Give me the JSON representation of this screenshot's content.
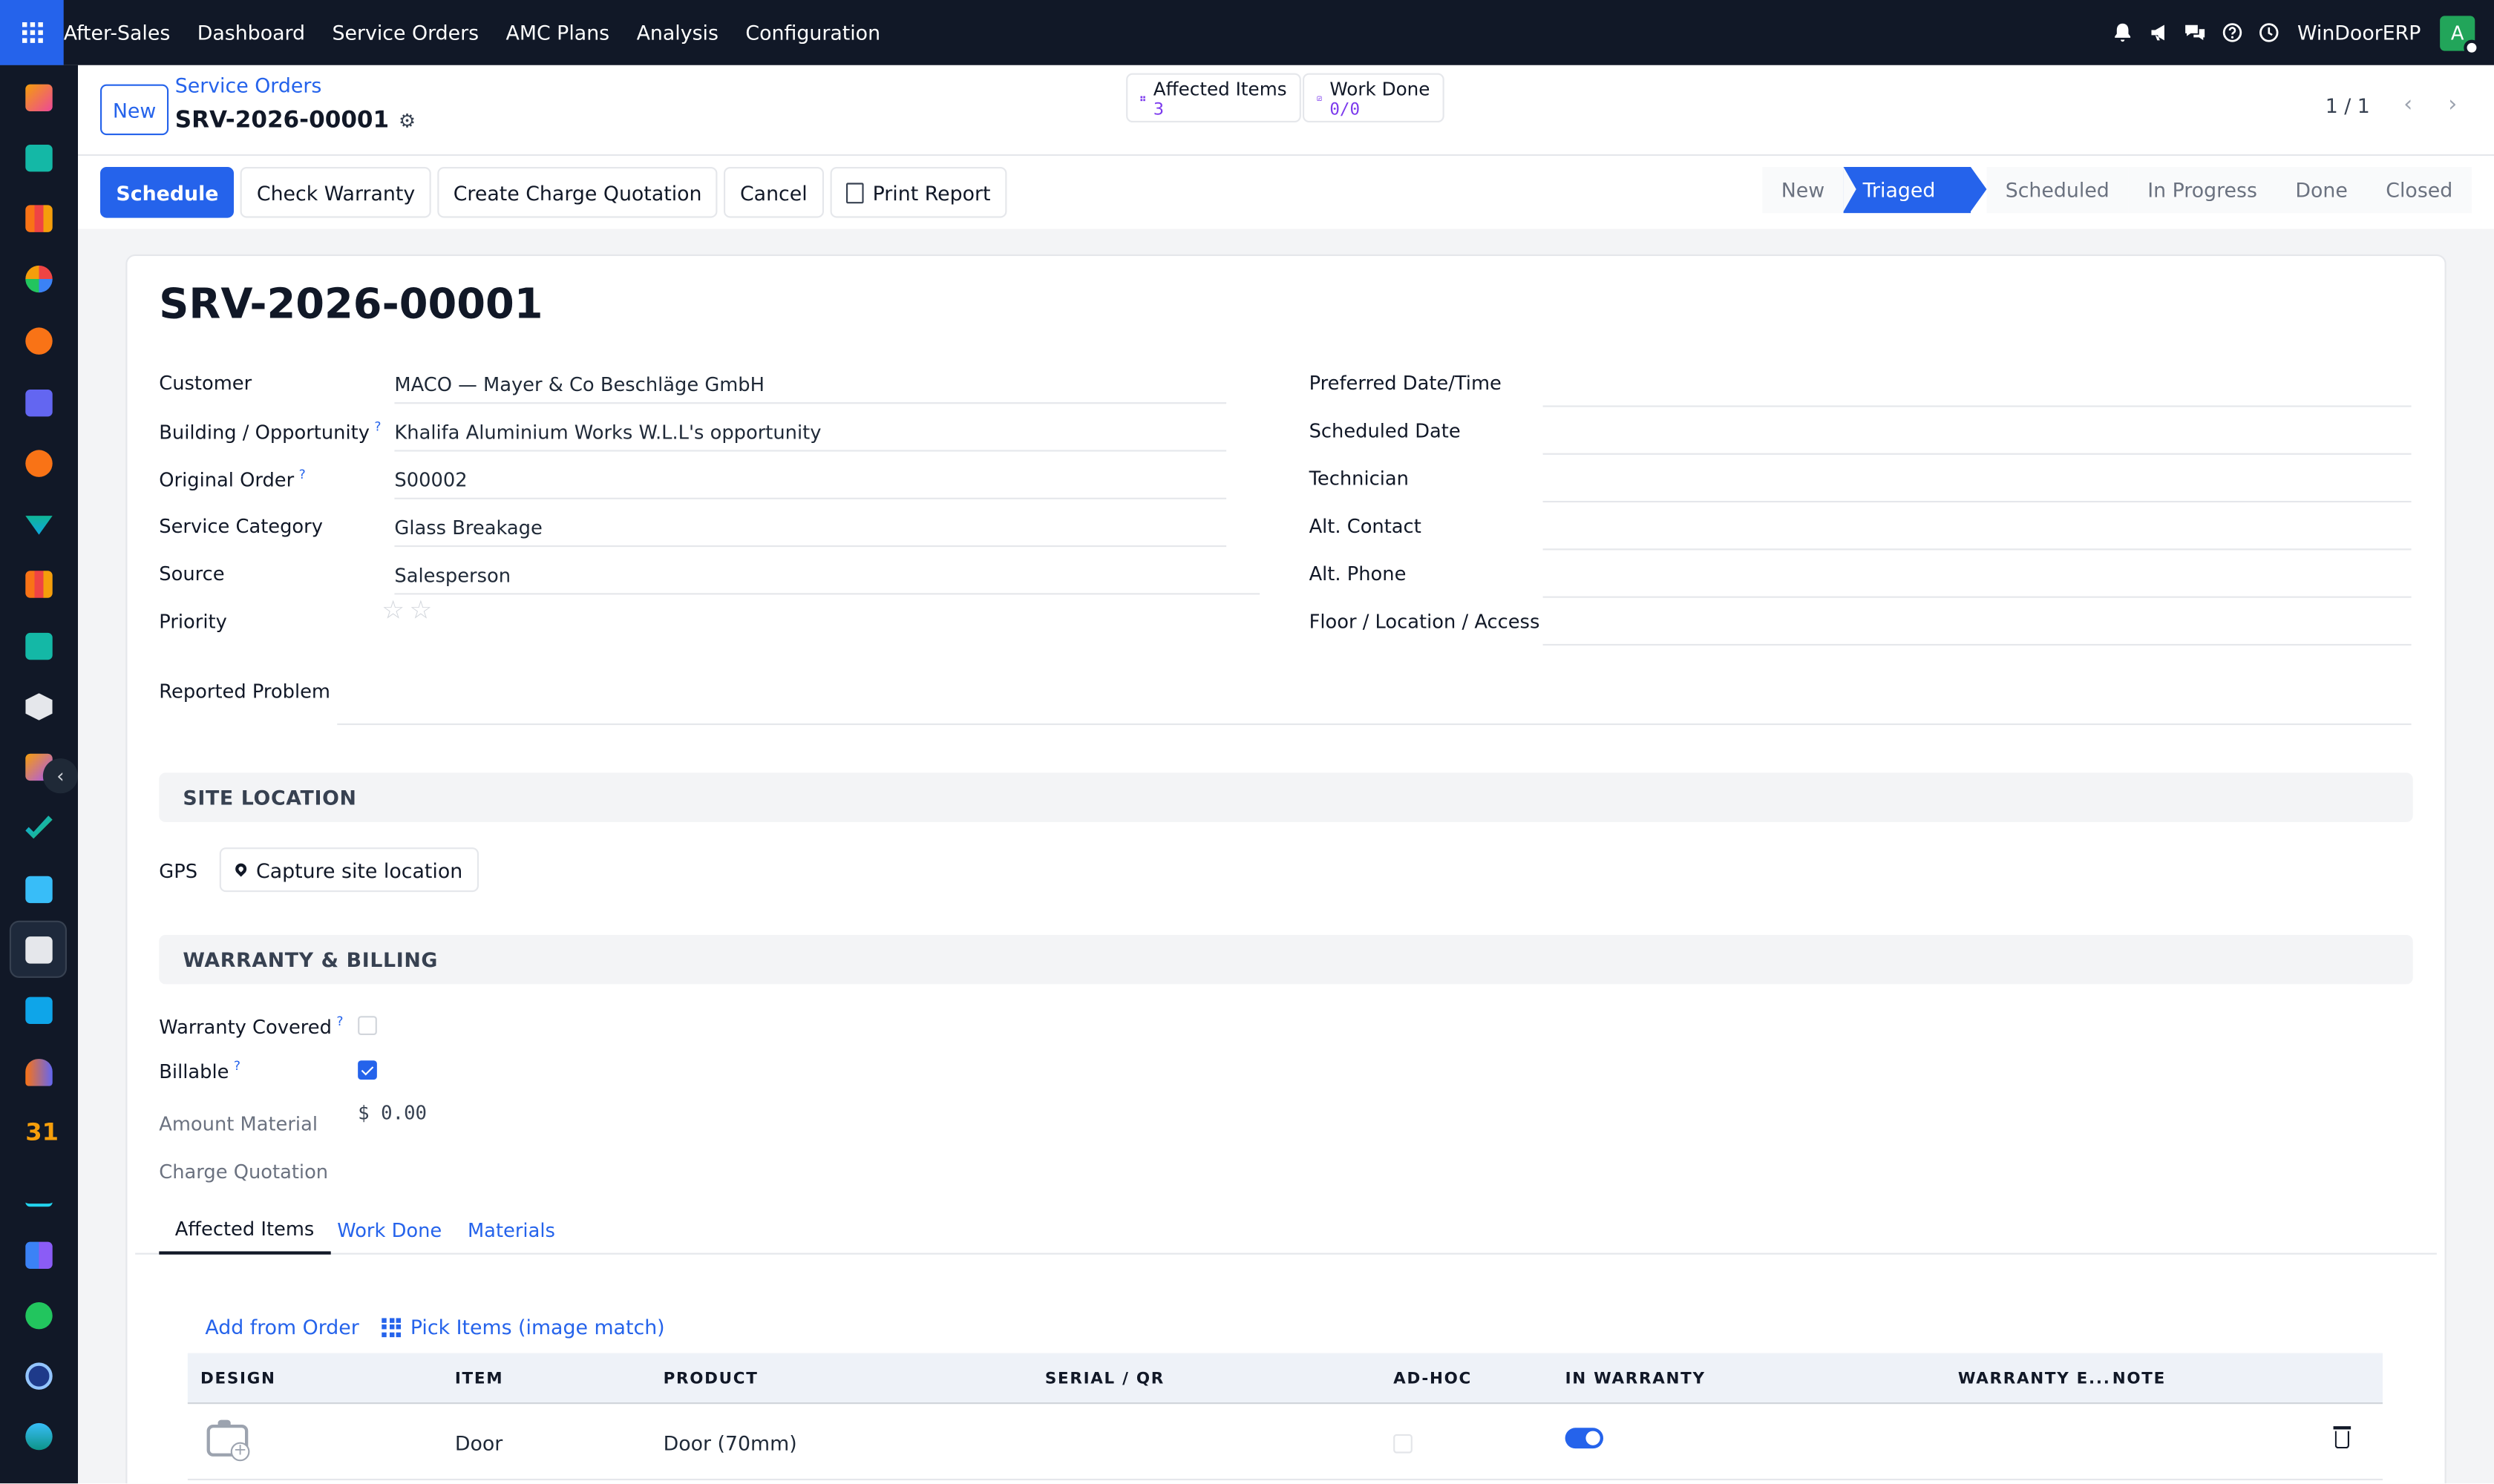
{
  "topbar": {
    "menu": [
      "After-Sales",
      "Dashboard",
      "Service Orders",
      "AMC Plans",
      "Analysis",
      "Configuration"
    ],
    "brand": "WinDoorERP",
    "avatar_letter": "A"
  },
  "control": {
    "new_label": "New",
    "breadcrumb_parent": "Service Orders",
    "breadcrumb_current": "SRV-2026-00001",
    "smart_buttons": [
      {
        "label": "Affected Items",
        "value": "3"
      },
      {
        "label": "Work Done",
        "value": "0/0"
      }
    ],
    "pager": "1 / 1"
  },
  "actions": [
    "Schedule",
    "Check Warranty",
    "Create Charge Quotation",
    "Cancel",
    "Print Report"
  ],
  "status_stages": [
    "New",
    "Triaged",
    "Scheduled",
    "In Progress",
    "Done",
    "Closed"
  ],
  "status_current": "Triaged",
  "record": {
    "title": "SRV-2026-00001",
    "left_fields": [
      {
        "label": "Customer",
        "value": "MACO — Mayer & Co Beschläge GmbH"
      },
      {
        "label": "Building / Opportunity",
        "value": "Khalifa Aluminium Works W.L.L's opportunity"
      },
      {
        "label": "Original Order",
        "value": "S00002"
      },
      {
        "label": "Service Category",
        "value": "Glass Breakage"
      },
      {
        "label": "Source",
        "value": "Salesperson"
      },
      {
        "label": "Priority",
        "value": ""
      }
    ],
    "right_fields": [
      {
        "label": "Preferred Date/Time",
        "value": ""
      },
      {
        "label": "Scheduled Date",
        "value": ""
      },
      {
        "label": "Technician",
        "value": ""
      },
      {
        "label": "Alt. Contact",
        "value": ""
      },
      {
        "label": "Alt. Phone",
        "value": ""
      },
      {
        "label": "Floor / Location / Access",
        "value": ""
      }
    ],
    "reported_problem_label": "Reported Problem",
    "priority_stars": 0
  },
  "site_location": {
    "title": "SITE LOCATION",
    "gps_label": "GPS",
    "capture_label": "Capture site location"
  },
  "warranty": {
    "title": "WARRANTY & BILLING",
    "warranty_covered_label": "Warranty Covered",
    "warranty_covered": false,
    "billable_label": "Billable",
    "billable": true,
    "amount_material_label": "Amount Material",
    "amount_material": "$ 0.00",
    "charge_quotation_label": "Charge Quotation"
  },
  "tabs": [
    "Affected Items",
    "Work Done",
    "Materials"
  ],
  "items_toolbar": {
    "add_from_order": "Add from Order",
    "pick_items": "Pick Items (image match)"
  },
  "items_table": {
    "columns": [
      "DESIGN",
      "ITEM",
      "PRODUCT",
      "SERIAL / QR",
      "AD-HOC",
      "IN WARRANTY",
      "WARRANTY E...",
      "NOTE"
    ],
    "rows": [
      {
        "item": "Door",
        "product": "Door (70mm)",
        "serial": "",
        "adhoc": false,
        "in_warranty": true,
        "warranty_end": "",
        "note": ""
      }
    ]
  },
  "colors": {
    "primary": "#2563eb",
    "topbar": "#111827",
    "accent_purple": "#7c3aed"
  }
}
